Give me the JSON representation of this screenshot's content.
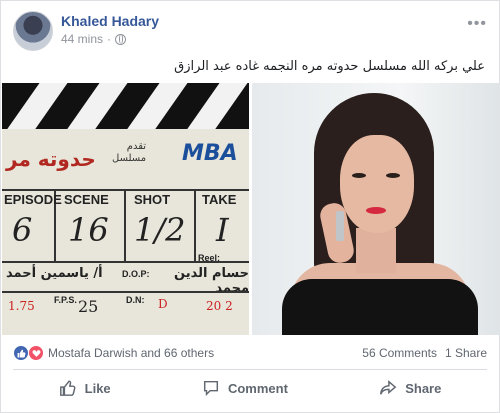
{
  "post": {
    "author": "Khaled Hadary",
    "time": "44 mins",
    "caption": "علي بركه الله مسلسل حدوته مره النجمه غاده عبد الرازق"
  },
  "clapperboard": {
    "title": "حدوته مر",
    "subtitle_line1": "تقدم",
    "subtitle_line2": "مسلسل",
    "logo": "MBA",
    "col_episode": "EPISODE",
    "col_scene": "SCENE",
    "col_shot": "SHOT",
    "col_take": "TAKE",
    "val_episode": "6",
    "val_scene": "16",
    "val_shot": "1/2",
    "val_take": "I",
    "reel_label": "Reel:",
    "director_line": "أ/ ياسمين أحمد",
    "dop_label": "D.O.P:",
    "dop_name": "حسام الدين محمد",
    "fps_label": "F.P.S.",
    "fps_value": "25",
    "dn_label": "D.N:",
    "dn_value": "D",
    "left_num": "1.75",
    "right_num": "20 2"
  },
  "footer": {
    "reactions_text": "Mostafa Darwish and 66 others",
    "comments": "56 Comments",
    "shares": "1 Share",
    "like_label": "Like",
    "comment_label": "Comment",
    "share_label": "Share"
  },
  "colors": {
    "link_blue": "#365899",
    "like_blue": "#4267b2",
    "love_red": "#f25268",
    "muted": "#606770"
  }
}
